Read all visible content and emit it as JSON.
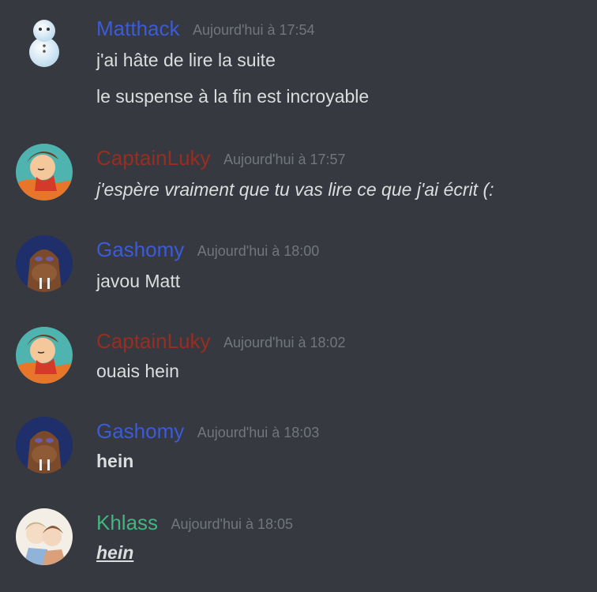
{
  "colors": {
    "background": "#36393f",
    "message_text": "#dcddde",
    "timestamp": "#72767d",
    "matthack": "#3b5bdb",
    "captainluky": "#992d22",
    "gashomy": "#3b5bdb",
    "khlass": "#43b581"
  },
  "messages": [
    {
      "author": "Matthack",
      "timestamp": "Aujourd'hui à 17:54",
      "avatar_icon": "snowman-avatar",
      "lines": [
        "j'ai hâte de lire la suite",
        "le suspense à la fin est incroyable"
      ]
    },
    {
      "author": "CaptainLuky",
      "timestamp": "Aujourd'hui à 17:57",
      "avatar_icon": "anime-character-avatar",
      "lines": [
        "j'espère vraiment que tu vas lire ce que j'ai écrit (:"
      ]
    },
    {
      "author": "Gashomy",
      "timestamp": "Aujourd'hui à 18:00",
      "avatar_icon": "walrus-avatar",
      "lines": [
        "javou Matt"
      ]
    },
    {
      "author": "CaptainLuky",
      "timestamp": "Aujourd'hui à 18:02",
      "avatar_icon": "anime-character-avatar",
      "lines": [
        "ouais hein"
      ]
    },
    {
      "author": "Gashomy",
      "timestamp": "Aujourd'hui à 18:03",
      "avatar_icon": "walrus-avatar",
      "lines": [
        "hein"
      ]
    },
    {
      "author": "Khlass",
      "timestamp": "Aujourd'hui à 18:05",
      "avatar_icon": "anime-duo-avatar",
      "lines": [
        "hein"
      ]
    }
  ]
}
